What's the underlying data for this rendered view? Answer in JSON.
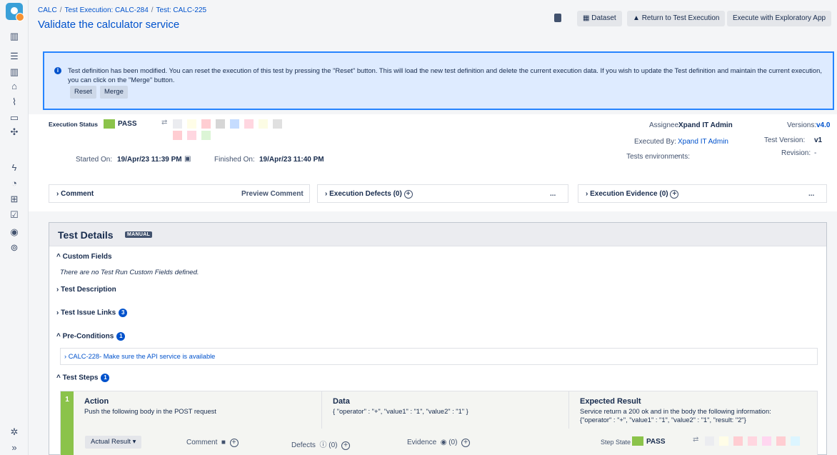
{
  "sidebar": {
    "icons": [
      "app-logo",
      "board-icon",
      "stack-icon",
      "columns-icon",
      "folder-icon",
      "chart-icon",
      "inbox-icon",
      "puzzle-icon",
      "lightning-icon",
      "rocket-icon",
      "tree-icon",
      "checklist-icon",
      "badge-icon",
      "gear-circle-icon",
      "settings-icon",
      "expand-icon"
    ],
    "expand_label": "»"
  },
  "header": {
    "breadcrumb": [
      "CALC",
      "Test Execution: CALC-284",
      "Test: CALC-225"
    ],
    "title": "Validate the calculator service",
    "buttons": {
      "dataset": "Dataset",
      "return": "Return to Test Execution",
      "exploratory": "Execute with Exploratory App"
    }
  },
  "banner": {
    "text": "Test definition has been modified. You can reset the execution of this test by pressing the \"Reset\" button. This will load the new test definition and delete the current execution data. If you wish to update the Test definition and maintain the current execution, you can click on the \"Merge\" button.",
    "reset": "Reset",
    "merge": "Merge"
  },
  "execution": {
    "status_label": "Execution Status",
    "status_value": "PASS",
    "status_color": "#8bc34a",
    "swatches": [
      "#ebecf0",
      "#fffde7",
      "#ffcdd2",
      "#d6d6d6",
      "#c5dcff",
      "#ffd6e0",
      "#fcfce4",
      "#e0e0e0",
      "#ffcdd2",
      "#ffd6e0",
      "#dcf5d6"
    ],
    "started_label": "Started On:",
    "started_value": "19/Apr/23 11:39 PM",
    "finished_label": "Finished On:",
    "finished_value": "19/Apr/23 11:40 PM",
    "assignee_label": "Assignee:",
    "assignee_value": "Xpand IT Admin",
    "executed_by_label": "Executed By:",
    "executed_by_value": "Xpand IT Admin",
    "envs_label": "Tests environments:",
    "envs_value": "-",
    "versions_label": "Versions:",
    "versions_value": "v4.0",
    "test_version_label": "Test Version:",
    "test_version_value": "v1",
    "revision_label": "Revision:",
    "revision_value": "-"
  },
  "panels": {
    "comment": "Comment",
    "preview_comment": "Preview Comment",
    "defects": "Execution Defects (0)",
    "evidence": "Execution Evidence (0)",
    "more": "..."
  },
  "details": {
    "title": "Test Details",
    "badge": "MANUAL",
    "custom_fields": "Custom Fields",
    "no_custom_fields": "There are no Test Run Custom Fields defined.",
    "description": "Test Description",
    "issue_links": "Test Issue Links",
    "issue_links_count": "3",
    "preconditions": "Pre-Conditions",
    "preconditions_count": "1",
    "precondition_item": "CALC-228- Make sure the API service is available",
    "test_steps": "Test Steps",
    "test_steps_count": "1"
  },
  "step": {
    "number": "1",
    "action_header": "Action",
    "action_body": "Push the following body in the POST request",
    "data_header": "Data",
    "data_body": "{ \"operator\" : \"+\", \"value1\" : \"1\", \"value2\" : \"1\" }",
    "expected_header": "Expected Result",
    "expected_body_1": "Service return a 200 ok and in the body the following information:",
    "expected_body_2": "{\"operator\" : \"+\", \"value1\" : \"1\", \"value2\" : \"1\", \"result: \"2\"}",
    "actual_result": "Actual Result",
    "comment": "Comment",
    "defects": "Defects",
    "defects_count": "(0)",
    "evidence": "Evidence",
    "evidence_count": "(0)",
    "step_state_label": "Step State",
    "step_state_value": "PASS",
    "swatches": [
      "#ebecf0",
      "#fffde7",
      "#ffcdd2",
      "#ffd6e0",
      "#ffd6f0",
      "#ffcdd2",
      "#dcf5ff"
    ]
  }
}
